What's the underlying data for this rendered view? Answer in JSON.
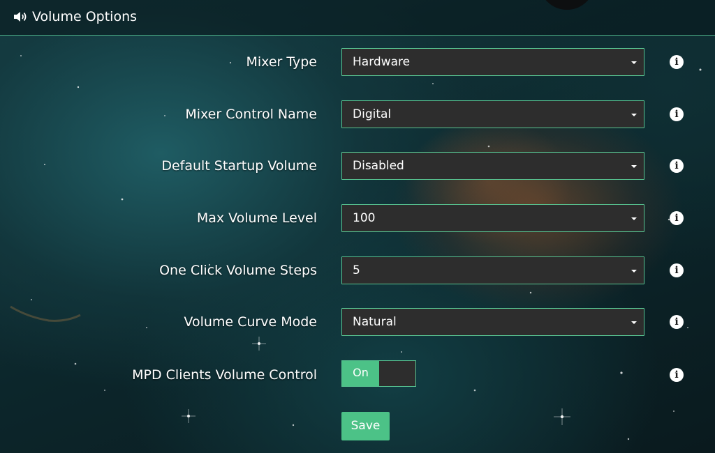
{
  "header": {
    "title": "Volume Options",
    "icon": "speaker-icon"
  },
  "settings": [
    {
      "label": "Mixer Type",
      "value": "Hardware"
    },
    {
      "label": "Mixer Control Name",
      "value": "Digital"
    },
    {
      "label": "Default Startup Volume",
      "value": "Disabled"
    },
    {
      "label": "Max Volume Level",
      "value": "100"
    },
    {
      "label": "One Click Volume Steps",
      "value": "5"
    },
    {
      "label": "Volume Curve Mode",
      "value": "Natural"
    }
  ],
  "mpd_clients": {
    "label": "MPD Clients Volume Control",
    "state": "On"
  },
  "info_icon_glyph": "i",
  "save_label": "Save",
  "colors": {
    "accent": "#4cc287",
    "field_bg": "#2d2d2d",
    "border": "#58c592"
  }
}
